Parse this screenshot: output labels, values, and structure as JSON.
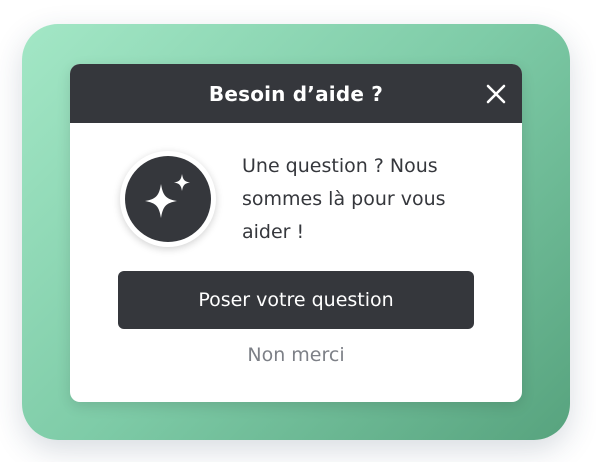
{
  "dialog": {
    "title": "Besoin d’aide ?",
    "message": "Une question ? Nous sommes là pour vous aider !",
    "primary_button": "Poser votre question",
    "secondary_link": "Non merci"
  },
  "icons": {
    "close": "close-icon",
    "avatar": "sparkles-icon"
  },
  "colors": {
    "header_bg": "#35373c",
    "accent_green_light": "#a3e7c6",
    "accent_green_dark": "#57a37e",
    "secondary_text": "#7d8087"
  }
}
